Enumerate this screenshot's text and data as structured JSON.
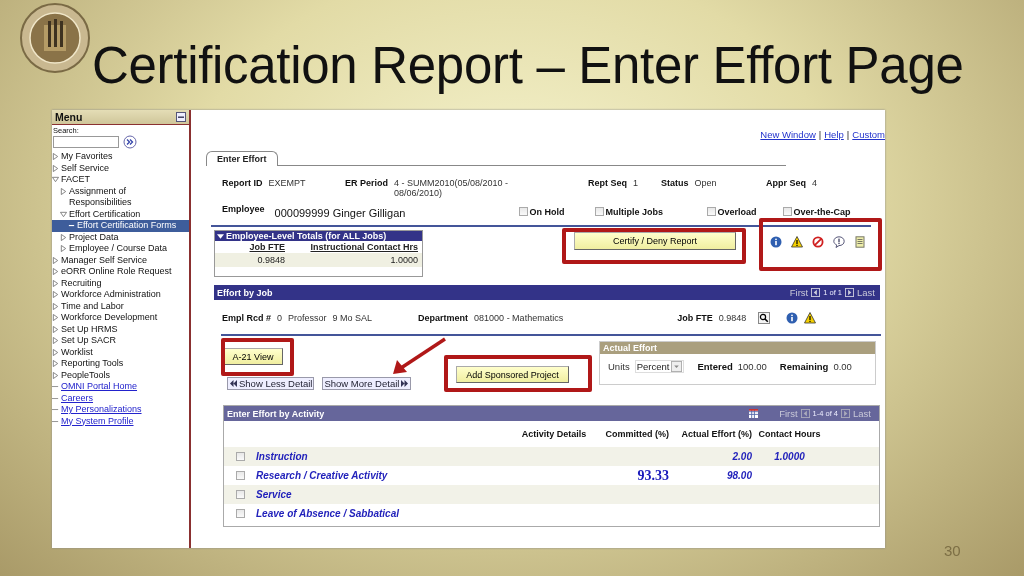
{
  "slide": {
    "title": "Certification Report – Enter Effort Page",
    "page_number": "30"
  },
  "menu": {
    "title": "Menu",
    "search_label": "Search:",
    "items": [
      {
        "label": "My Favorites",
        "kind": "folder",
        "expanded": false,
        "selected": false
      },
      {
        "label": "Self Service",
        "kind": "folder",
        "expanded": false,
        "selected": false
      },
      {
        "label": "FACET",
        "kind": "folder",
        "expanded": true,
        "selected": false,
        "children": [
          {
            "label": "Assignment of Responsibilities",
            "kind": "folder",
            "expanded": false,
            "selected": false
          },
          {
            "label": "Effort Certification",
            "kind": "folder",
            "expanded": true,
            "selected": false,
            "children": [
              {
                "label": "Effort Certification Forms",
                "kind": "page",
                "selected": true
              }
            ]
          },
          {
            "label": "Project Data",
            "kind": "folder",
            "expanded": false,
            "selected": false
          },
          {
            "label": "Employee / Course Data",
            "kind": "folder",
            "expanded": false,
            "selected": false
          }
        ]
      },
      {
        "label": "Manager Self Service",
        "kind": "folder",
        "expanded": false,
        "selected": false
      },
      {
        "label": "eORR Online Role Request",
        "kind": "folder",
        "expanded": false,
        "selected": false
      },
      {
        "label": "Recruiting",
        "kind": "folder",
        "expanded": false,
        "selected": false
      },
      {
        "label": "Workforce Administration",
        "kind": "folder",
        "expanded": false,
        "selected": false
      },
      {
        "label": "Time and Labor",
        "kind": "folder",
        "expanded": false,
        "selected": false
      },
      {
        "label": "Workforce Development",
        "kind": "folder",
        "expanded": false,
        "selected": false
      },
      {
        "label": "Set Up HRMS",
        "kind": "folder",
        "expanded": false,
        "selected": false
      },
      {
        "label": "Set Up SACR",
        "kind": "folder",
        "expanded": false,
        "selected": false
      },
      {
        "label": "Worklist",
        "kind": "folder",
        "expanded": false,
        "selected": false
      },
      {
        "label": "Reporting Tools",
        "kind": "folder",
        "expanded": false,
        "selected": false
      },
      {
        "label": "PeopleTools",
        "kind": "folder",
        "expanded": false,
        "selected": false
      },
      {
        "label": "OMNI Portal Home",
        "kind": "link",
        "selected": false
      },
      {
        "label": "Careers",
        "kind": "link",
        "selected": false
      },
      {
        "label": "My Personalizations",
        "kind": "link",
        "selected": false
      },
      {
        "label": "My System Profile",
        "kind": "link",
        "selected": false
      }
    ]
  },
  "header_links": {
    "links": [
      "New Window",
      "Help",
      "Custom"
    ],
    "separator": "|"
  },
  "tabs": [
    {
      "label": "Enter Effort",
      "selected": true
    }
  ],
  "report": {
    "fields": [
      {
        "label": "Report ID",
        "value": "EXEMPT"
      },
      {
        "label": "ER Period",
        "value": "4 - SUMM2010(05/08/2010 - 08/06/2010)"
      },
      {
        "label": "Rept Seq",
        "value": "1"
      },
      {
        "label": "Status",
        "value": "Open"
      },
      {
        "label": "Appr Seq",
        "value": "4"
      }
    ],
    "employee": {
      "label": "Employee",
      "value": "000099999 Ginger Gilligan"
    },
    "flags": [
      {
        "label": "On Hold",
        "checked": false
      },
      {
        "label": "Multiple Jobs",
        "checked": false
      },
      {
        "label": "Overload",
        "checked": false
      },
      {
        "label": "Over-the-Cap",
        "checked": false
      }
    ]
  },
  "totals": {
    "title": "Employee-Level Totals (for ALL Jobs)",
    "expanded": true,
    "columns": [
      "Job FTE",
      "Instructional Contact Hrs"
    ],
    "row": [
      "0.9848",
      "1.0000"
    ]
  },
  "certify_button": "Certify / Deny Report",
  "effort_by_job": {
    "title": "Effort by Job",
    "pager": {
      "first": "First",
      "range": "1 of 1",
      "last": "Last"
    },
    "empl_rcd": {
      "label": "Empl Rcd #",
      "value": "0"
    },
    "job_title": "Professor",
    "pay_type": "9 Mo SAL",
    "department": {
      "label": "Department",
      "value": "081000 - Mathematics"
    },
    "job_fte": {
      "label": "Job FTE",
      "value": "0.9848"
    }
  },
  "a21_button": "A-21 View",
  "detail_buttons": [
    {
      "label": "Show Less Detail",
      "kind": "less"
    },
    {
      "label": "Show More Detail",
      "kind": "more"
    }
  ],
  "add_project_button": "Add Sponsored Project",
  "actual_effort": {
    "title": "Actual Effort",
    "units": {
      "label": "Units",
      "value": "Percent"
    },
    "entered": {
      "label": "Entered",
      "value": "100.00"
    },
    "remaining": {
      "label": "Remaining",
      "value": "0.00"
    }
  },
  "activity_grid": {
    "title": "Enter Effort by Activity",
    "pager": {
      "first": "First",
      "range": "1-4 of 4",
      "last": "Last"
    },
    "columns": [
      "Activity Details",
      "Committed (%)",
      "Actual Effort (%)",
      "Contact Hours"
    ],
    "rows": [
      {
        "activity": "Instruction",
        "checked": false,
        "actual": "2.00",
        "contact_hours": "1.0000"
      },
      {
        "activity": "Research / Creative Activity",
        "checked": false,
        "committed": "93.33",
        "actual": "98.00"
      },
      {
        "activity": "Service",
        "checked": false
      },
      {
        "activity": "Leave of Absence / Sabbatical",
        "checked": false
      }
    ]
  }
}
